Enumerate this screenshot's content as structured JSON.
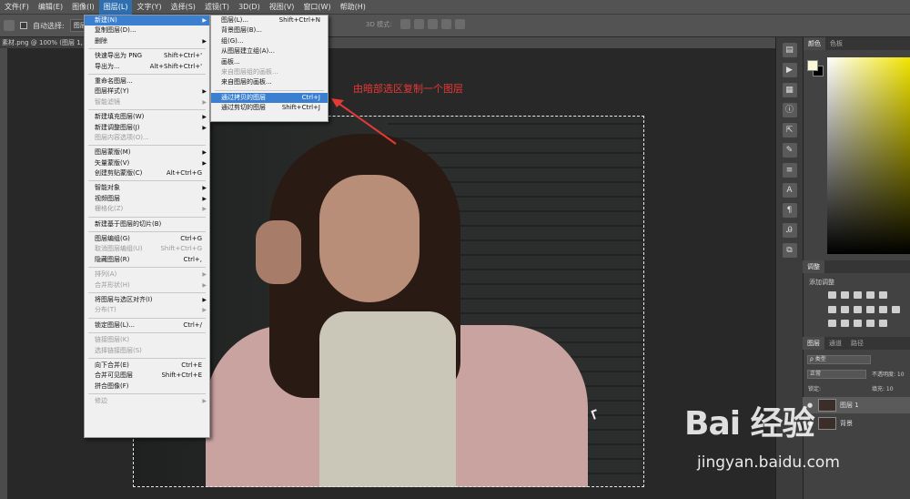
{
  "menubar": {
    "items": [
      {
        "label": "文件(F)",
        "active": false
      },
      {
        "label": "编辑(E)",
        "active": false
      },
      {
        "label": "图像(I)",
        "active": false
      },
      {
        "label": "图层(L)",
        "active": true
      },
      {
        "label": "文字(Y)",
        "active": false
      },
      {
        "label": "选择(S)",
        "active": false
      },
      {
        "label": "滤镜(T)",
        "active": false
      },
      {
        "label": "3D(D)",
        "active": false
      },
      {
        "label": "视图(V)",
        "active": false
      },
      {
        "label": "窗口(W)",
        "active": false
      },
      {
        "label": "帮助(H)",
        "active": false
      }
    ]
  },
  "optbar": {
    "auto_select": "自动选择:",
    "select_value": "图层",
    "mode_3d": "3D 模式:"
  },
  "doc_tab": "素材.png @ 100% (图层 1, RG",
  "layer_menu": {
    "items": [
      {
        "label": "新建(N)",
        "shortcut": "",
        "sub": true,
        "state": "hl"
      },
      {
        "label": "复制图层(D)...",
        "shortcut": "",
        "sub": false,
        "state": ""
      },
      {
        "label": "删除",
        "shortcut": "",
        "sub": true,
        "state": ""
      },
      {
        "sep": true
      },
      {
        "label": "快速导出为 PNG",
        "shortcut": "Shift+Ctrl+'",
        "sub": false,
        "state": ""
      },
      {
        "label": "导出为...",
        "shortcut": "Alt+Shift+Ctrl+'",
        "sub": false,
        "state": ""
      },
      {
        "sep": true
      },
      {
        "label": "重命名图层...",
        "shortcut": "",
        "sub": false,
        "state": ""
      },
      {
        "label": "图层样式(Y)",
        "shortcut": "",
        "sub": true,
        "state": ""
      },
      {
        "label": "智能滤镜",
        "shortcut": "",
        "sub": true,
        "state": "dis"
      },
      {
        "sep": true
      },
      {
        "label": "新建填充图层(W)",
        "shortcut": "",
        "sub": true,
        "state": ""
      },
      {
        "label": "新建调整图层(J)",
        "shortcut": "",
        "sub": true,
        "state": ""
      },
      {
        "label": "图层内容选项(O)...",
        "shortcut": "",
        "sub": false,
        "state": "dis"
      },
      {
        "sep": true
      },
      {
        "label": "图层蒙版(M)",
        "shortcut": "",
        "sub": true,
        "state": ""
      },
      {
        "label": "矢量蒙版(V)",
        "shortcut": "",
        "sub": true,
        "state": ""
      },
      {
        "label": "创建剪贴蒙版(C)",
        "shortcut": "Alt+Ctrl+G",
        "sub": false,
        "state": ""
      },
      {
        "sep": true
      },
      {
        "label": "智能对象",
        "shortcut": "",
        "sub": true,
        "state": ""
      },
      {
        "label": "视频图层",
        "shortcut": "",
        "sub": true,
        "state": ""
      },
      {
        "label": "栅格化(Z)",
        "shortcut": "",
        "sub": true,
        "state": "dis"
      },
      {
        "sep": true
      },
      {
        "label": "新建基于图层的切片(B)",
        "shortcut": "",
        "sub": false,
        "state": ""
      },
      {
        "sep": true
      },
      {
        "label": "图层编组(G)",
        "shortcut": "Ctrl+G",
        "sub": false,
        "state": ""
      },
      {
        "label": "取消图层编组(U)",
        "shortcut": "Shift+Ctrl+G",
        "sub": false,
        "state": "dis"
      },
      {
        "label": "隐藏图层(R)",
        "shortcut": "Ctrl+,",
        "sub": false,
        "state": ""
      },
      {
        "sep": true
      },
      {
        "label": "排列(A)",
        "shortcut": "",
        "sub": true,
        "state": "dis"
      },
      {
        "label": "合并形状(H)",
        "shortcut": "",
        "sub": true,
        "state": "dis"
      },
      {
        "sep": true
      },
      {
        "label": "将图层与选区对齐(I)",
        "shortcut": "",
        "sub": true,
        "state": ""
      },
      {
        "label": "分布(T)",
        "shortcut": "",
        "sub": true,
        "state": "dis"
      },
      {
        "sep": true
      },
      {
        "label": "锁定图层(L)...",
        "shortcut": "Ctrl+/",
        "sub": false,
        "state": ""
      },
      {
        "sep": true
      },
      {
        "label": "链接图层(K)",
        "shortcut": "",
        "sub": false,
        "state": "dis"
      },
      {
        "label": "选择链接图层(S)",
        "shortcut": "",
        "sub": false,
        "state": "dis"
      },
      {
        "sep": true
      },
      {
        "label": "向下合并(E)",
        "shortcut": "Ctrl+E",
        "sub": false,
        "state": ""
      },
      {
        "label": "合并可见图层",
        "shortcut": "Shift+Ctrl+E",
        "sub": false,
        "state": ""
      },
      {
        "label": "拼合图像(F)",
        "shortcut": "",
        "sub": false,
        "state": ""
      },
      {
        "sep": true
      },
      {
        "label": "修边",
        "shortcut": "",
        "sub": true,
        "state": "dis"
      }
    ]
  },
  "new_submenu": {
    "items": [
      {
        "label": "图层(L)...",
        "shortcut": "Shift+Ctrl+N",
        "state": ""
      },
      {
        "label": "背景图层(B)...",
        "shortcut": "",
        "state": ""
      },
      {
        "label": "组(G)...",
        "shortcut": "",
        "state": ""
      },
      {
        "label": "从图层建立组(A)...",
        "shortcut": "",
        "state": ""
      },
      {
        "label": "画板...",
        "shortcut": "",
        "state": ""
      },
      {
        "label": "来自图层组的画板...",
        "shortcut": "",
        "state": "dis"
      },
      {
        "label": "来自图层的画板...",
        "shortcut": "",
        "state": ""
      },
      {
        "sep": true
      },
      {
        "label": "通过拷贝的图层",
        "shortcut": "Ctrl+J",
        "state": "hl"
      },
      {
        "label": "通过剪切的图层",
        "shortcut": "Shift+Ctrl+J",
        "state": ""
      }
    ]
  },
  "annotation": "由暗部选区复制一个图层",
  "right_panel": {
    "color_tabs": [
      "颜色",
      "色板"
    ],
    "adjust_tab": "调整",
    "adjust_add": "添加调整",
    "layers_tabs": [
      "图层",
      "通道",
      "路径"
    ],
    "kind": "ρ 类型",
    "blend": "正常",
    "opacity": "不透明度: 10",
    "lock": "锁定:",
    "fill": "填充: 10",
    "layers": [
      {
        "name": "图层 1",
        "selected": true
      },
      {
        "name": "背景",
        "selected": false
      }
    ]
  },
  "watermark": {
    "logo": "Bai 经验",
    "url": "jingyan.baidu.com"
  },
  "colors": {
    "menu_highlight": "#3a7fd0",
    "annotation": "#e53935",
    "panel_bg": "#424242"
  }
}
